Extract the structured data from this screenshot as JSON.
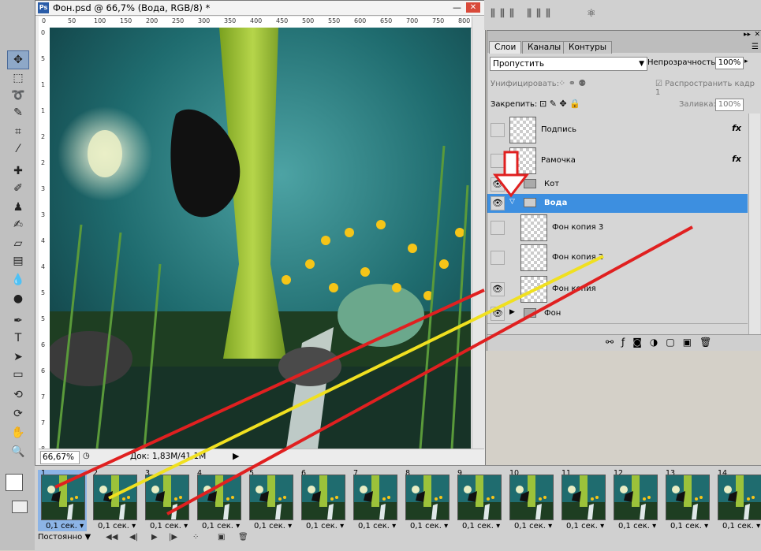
{
  "document": {
    "title": "Фон.psd @ 66,7% (Вода, RGB/8) *",
    "zoom": "66,67%",
    "doc_info": "Док: 1,83M/41,1M",
    "ruler_top": [
      "0",
      "50",
      "100",
      "150",
      "200",
      "250",
      "300",
      "350",
      "400",
      "450",
      "500",
      "550",
      "600",
      "650",
      "700",
      "750",
      "800"
    ],
    "ruler_left": [
      "0",
      "5",
      "1",
      "1",
      "2",
      "2",
      "3",
      "3",
      "4",
      "4",
      "5",
      "5",
      "6",
      "6",
      "7",
      "7",
      "8"
    ]
  },
  "layers_panel": {
    "tabs": [
      "Слои",
      "Каналы",
      "Контуры"
    ],
    "blend_mode": "Пропустить",
    "opacity_label": "Непрозрачность:",
    "opacity_value": "100%",
    "unify_label": "Унифицировать:",
    "propagate_label": "Распространить кадр 1",
    "lock_label": "Закрепить:",
    "fill_label": "Заливка:",
    "fill_value": "100%",
    "layers": [
      {
        "name": "Подпись",
        "fx": "fx",
        "visible": false,
        "kind": "layer"
      },
      {
        "name": "Рамочка",
        "fx": "fx",
        "visible": false,
        "kind": "layer"
      },
      {
        "name": "Кот",
        "visible": true,
        "kind": "group"
      },
      {
        "name": "Вода",
        "visible": true,
        "kind": "group-open",
        "selected": true
      },
      {
        "name": "Фон копия 3",
        "visible": false,
        "kind": "layer"
      },
      {
        "name": "Фон копия 2",
        "visible": false,
        "kind": "layer"
      },
      {
        "name": "Фон копия",
        "visible": true,
        "kind": "layer"
      },
      {
        "name": "Фон",
        "visible": true,
        "kind": "group"
      }
    ]
  },
  "animation": {
    "frames": [
      {
        "n": "1",
        "time": "0,1 сек."
      },
      {
        "n": "2",
        "time": "0,1 сек."
      },
      {
        "n": "3",
        "time": "0,1 сек."
      },
      {
        "n": "4",
        "time": "0,1 сек."
      },
      {
        "n": "5",
        "time": "0,1 сек."
      },
      {
        "n": "6",
        "time": "0,1 сек."
      },
      {
        "n": "7",
        "time": "0,1 сек."
      },
      {
        "n": "8",
        "time": "0,1 сек."
      },
      {
        "n": "9",
        "time": "0,1 сек."
      },
      {
        "n": "10",
        "time": "0,1 сек."
      },
      {
        "n": "11",
        "time": "0,1 сек."
      },
      {
        "n": "12",
        "time": "0,1 сек."
      },
      {
        "n": "13",
        "time": "0,1 сек."
      },
      {
        "n": "14",
        "time": "0,1 сек."
      }
    ],
    "loop": "Постоянно"
  },
  "colors": {
    "selection": "#3d8fe0",
    "annotation_red": "#e02020",
    "annotation_yellow": "#f0e020"
  }
}
